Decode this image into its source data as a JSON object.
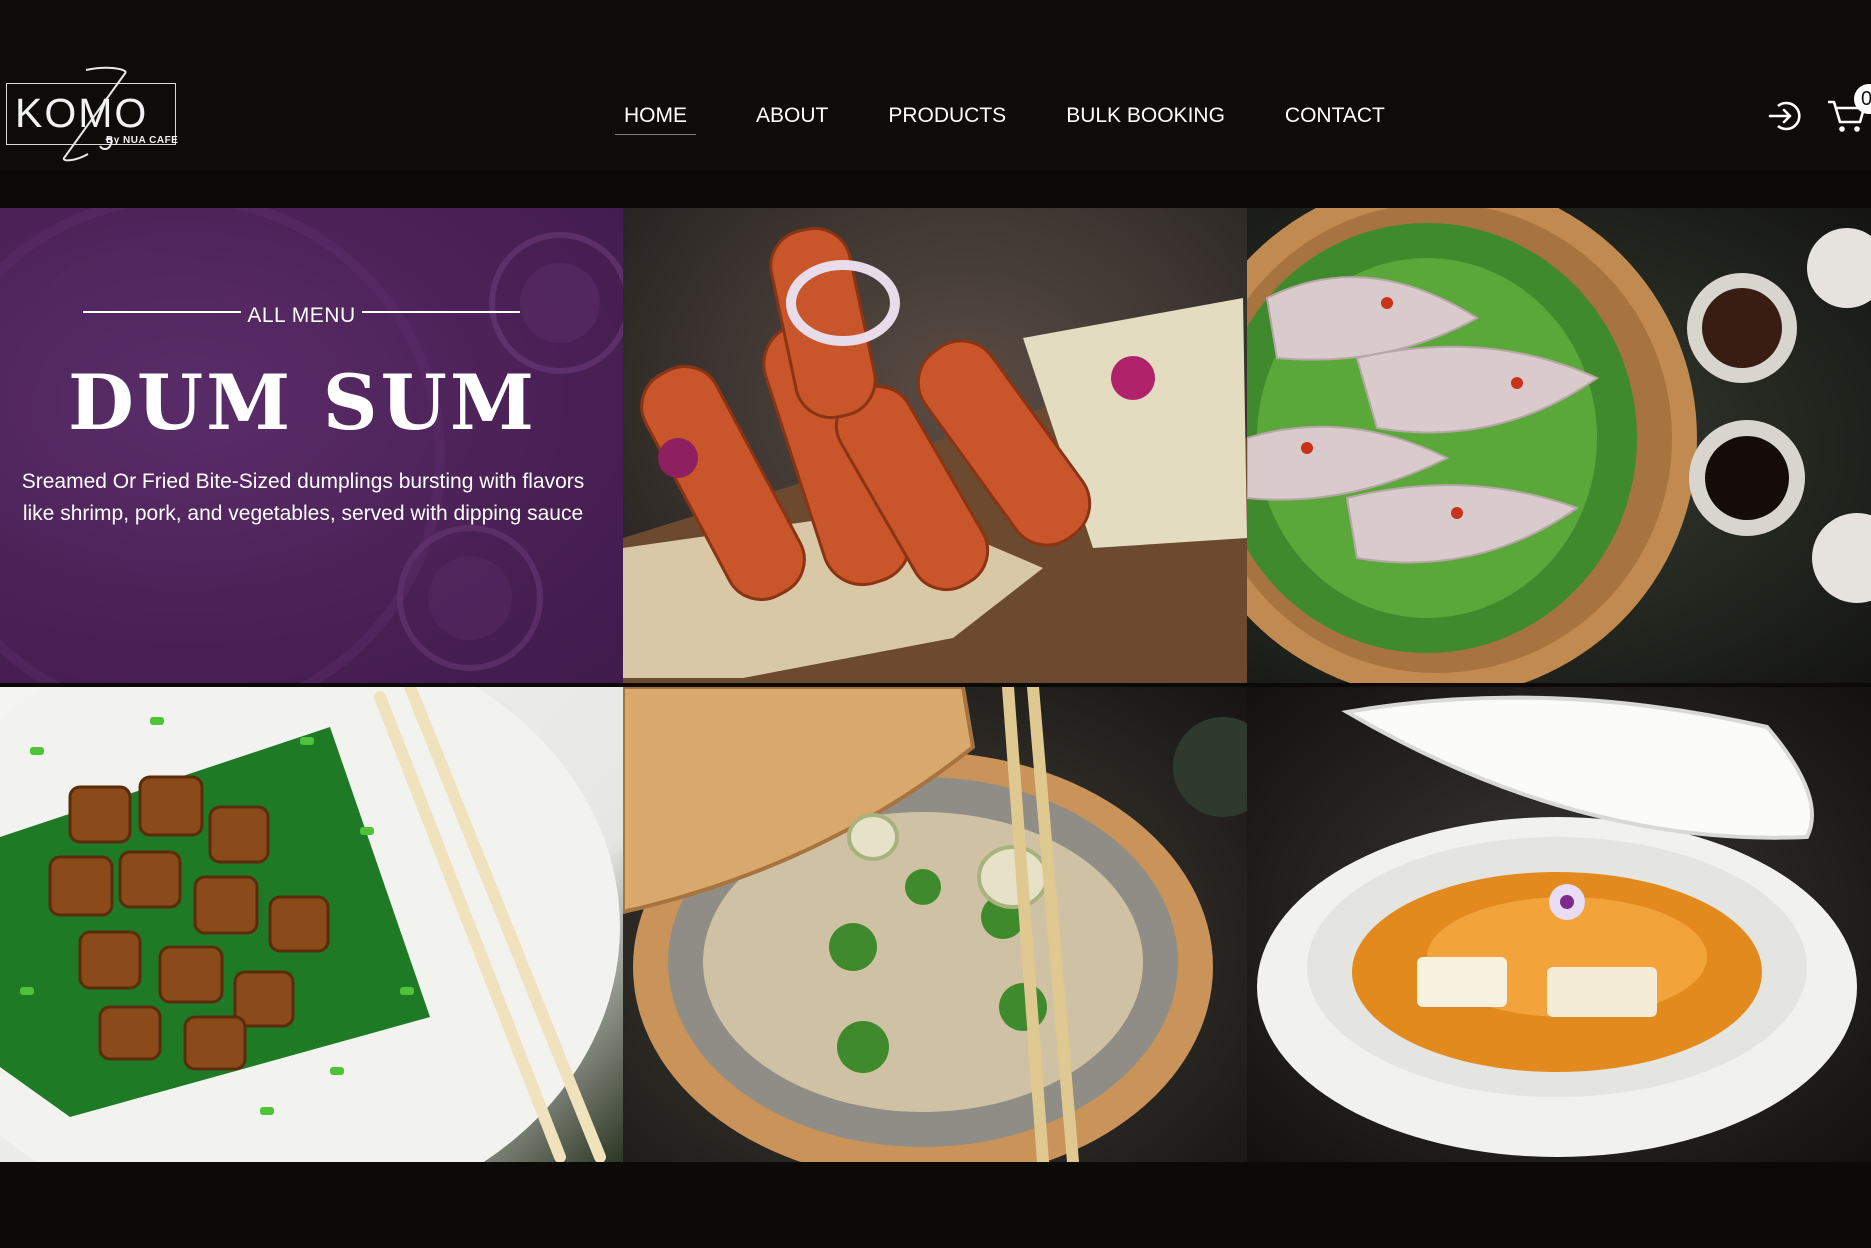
{
  "brand": {
    "logo_word": "KOMO",
    "logo_sub": "By NUA CAFE"
  },
  "nav": {
    "items": [
      {
        "label": "HOME",
        "active": true
      },
      {
        "label": "ABOUT",
        "active": false
      },
      {
        "label": "PRODUCTS",
        "active": false
      },
      {
        "label": "BULK BOOKING",
        "active": false
      },
      {
        "label": "CONTACT",
        "active": false
      }
    ]
  },
  "header_icons": {
    "login": "login-arrow-icon",
    "cart": "shopping-cart-icon",
    "cart_count": "0"
  },
  "promo": {
    "kicker": "ALL MENU",
    "title": "DUM SUM",
    "description": "Sreamed Or Fried Bite-Sized dumplings bursting with flavors like shrimp, pork, and vegetables, served with dipping sauce"
  },
  "colors": {
    "background": "#0d0c09",
    "promo_purple": "#4b2157",
    "nav_text": "#ffffff"
  }
}
